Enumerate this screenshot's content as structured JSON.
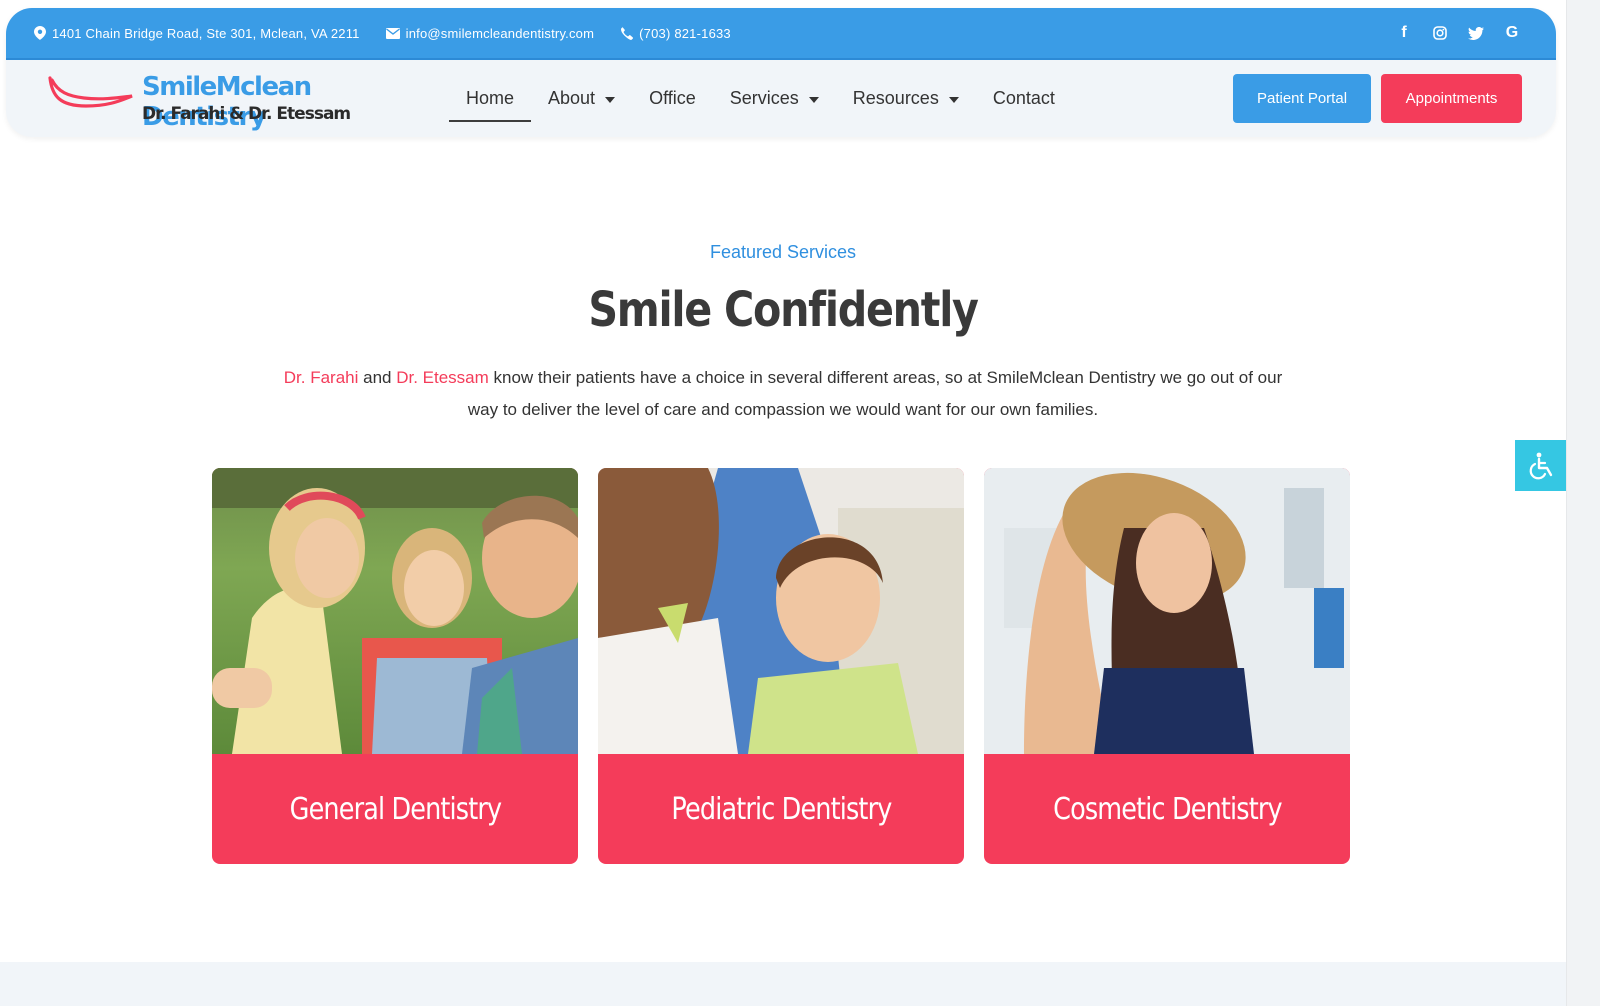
{
  "topbar": {
    "address": "1401 Chain Bridge Road, Ste 301, Mclean, VA 2211",
    "email": "info@smilemcleandentistry.com",
    "phone": "(703) 821-1633",
    "social": [
      {
        "icon": "facebook-icon",
        "glyph": "f"
      },
      {
        "icon": "instagram-icon",
        "glyph": ""
      },
      {
        "icon": "twitter-icon",
        "glyph": ""
      },
      {
        "icon": "google-icon",
        "glyph": "G"
      }
    ]
  },
  "logo": {
    "brand": "SmileMclean Dentistry",
    "doctors": "Dr. Farahi & Dr. Etessam"
  },
  "nav": {
    "items": [
      {
        "label": "Home",
        "active": true,
        "dropdown": false
      },
      {
        "label": "About",
        "active": false,
        "dropdown": true
      },
      {
        "label": "Office",
        "active": false,
        "dropdown": false
      },
      {
        "label": "Services",
        "active": false,
        "dropdown": true
      },
      {
        "label": "Resources",
        "active": false,
        "dropdown": true
      },
      {
        "label": "Contact",
        "active": false,
        "dropdown": false
      }
    ]
  },
  "buttons": {
    "patient_portal": "Patient Portal",
    "appointments": "Appointments"
  },
  "hero": {
    "eyebrow": "Featured Services",
    "title": "Smile Confidently",
    "intro": {
      "doctor1": "Dr. Farahi",
      "joiner": " and ",
      "doctor2": "Dr. Etessam",
      "rest": " know their patients have a choice in several different areas, so at SmileMclean Dentistry we go out of our way to deliver the level of care and compassion we would want for our own families."
    }
  },
  "cards": [
    {
      "label": "General Dentistry",
      "photo": "family-selfie-photo"
    },
    {
      "label": "Pediatric Dentistry",
      "photo": "child-dental-chair-photo"
    },
    {
      "label": "Cosmetic Dentistry",
      "photo": "woman-sunhat-photo"
    }
  ],
  "colors": {
    "brand_blue": "#3a9ce6",
    "brand_red": "#f43c5a",
    "accessibility_cyan": "#35c7e3"
  }
}
